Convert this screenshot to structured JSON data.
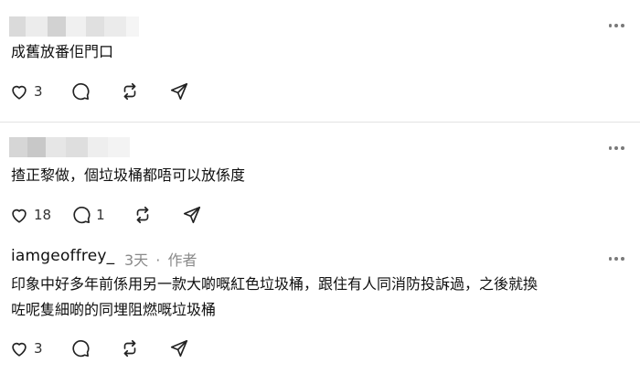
{
  "posts": [
    {
      "username_redacted": true,
      "text": "成舊放番佢門口",
      "likes": "3",
      "replies": ""
    },
    {
      "username_redacted": true,
      "text": "揸正黎做，個垃圾桶都唔可以放係度",
      "likes": "18",
      "replies": "1"
    },
    {
      "username": "iamgeoffrey_",
      "time": "3天",
      "separator": "·",
      "author_tag": "作者",
      "text_line1": "印象中好多年前係用另一款大啲嘅紅色垃圾桶，跟住有人同消防投訴過，之後就換",
      "text_line2": "咗呢隻細啲的同埋阻燃嘅垃圾桶",
      "likes": "3",
      "replies": ""
    }
  ],
  "icons": [
    "heart-icon",
    "comment-icon",
    "repost-icon",
    "share-icon",
    "more-icon"
  ],
  "colors": {
    "text": "#101010",
    "muted": "#8a8a8a",
    "divider": "#e3e3e3"
  }
}
